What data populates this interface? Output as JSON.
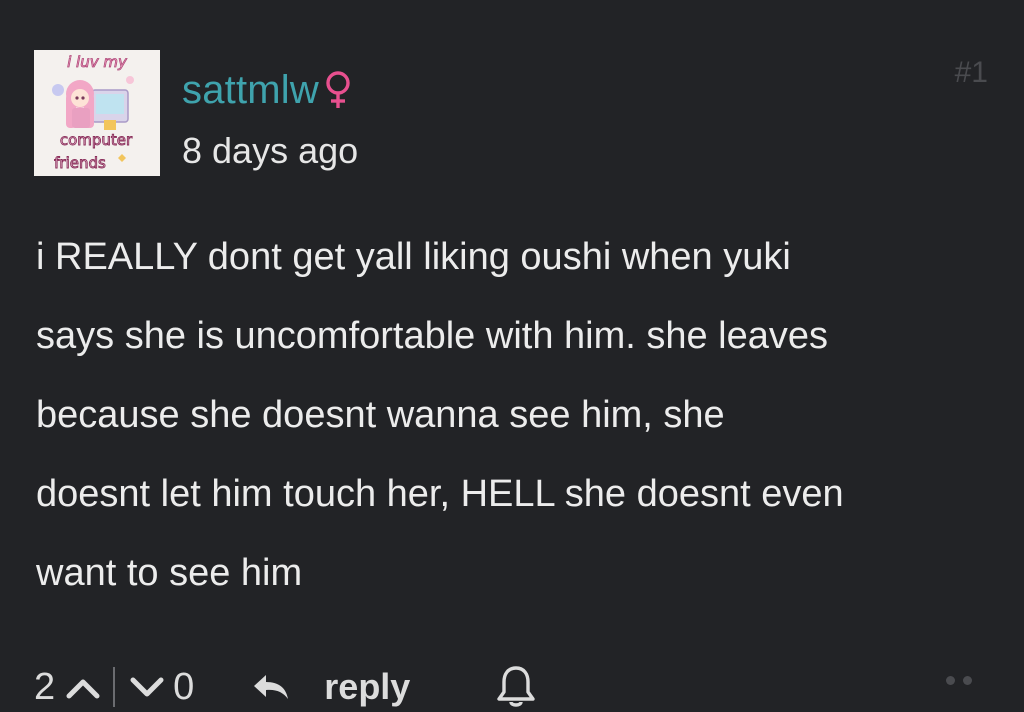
{
  "comment": {
    "avatar": {
      "label_line1": "i luv my",
      "label_line2": "computer",
      "label_line3": "friends",
      "description_icon": "anime-avatar"
    },
    "username": "sattmlw",
    "gender_icon": "female-symbol-icon",
    "timestamp": "8 days ago",
    "post_number": "#1",
    "body_lines": [
      "i REALLY dont get yall liking oushi when yuki",
      "says she is uncomfortable with him. she leaves",
      "because she doesnt wanna see him, she",
      "doesnt let him touch her, HELL she doesnt even",
      "want to see him"
    ],
    "upvotes": "2",
    "downvotes": "0",
    "reply_label": "reply"
  },
  "colors": {
    "background": "#222326",
    "username": "#3fa3ad",
    "gender": "#e8508f",
    "text": "#ececec",
    "muted": "#4a4b4f"
  }
}
